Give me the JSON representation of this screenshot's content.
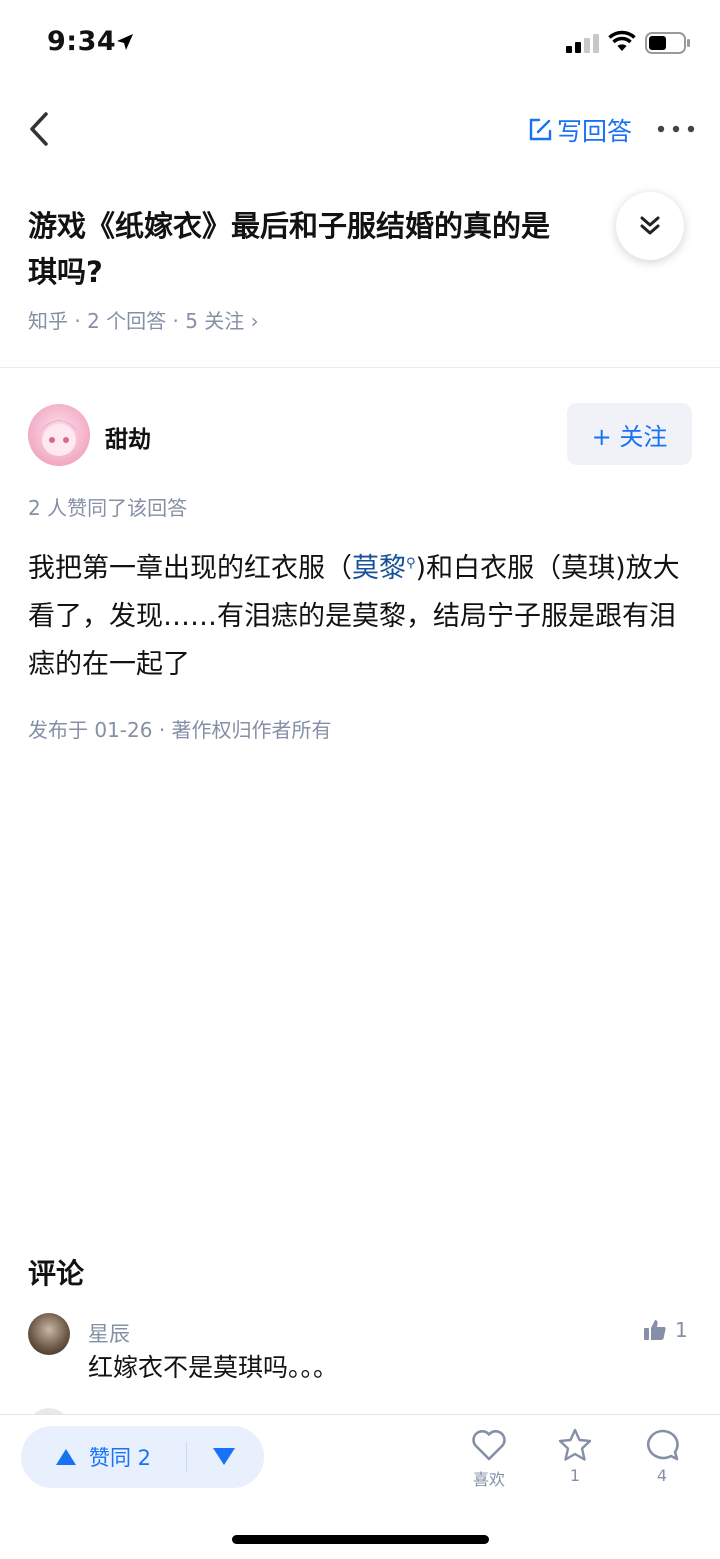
{
  "status_bar": {
    "time": "9:34"
  },
  "nav": {
    "write_answer": "写回答"
  },
  "question": {
    "title": "游戏《纸嫁衣》最后和子服结婚的真的是莫琪吗?",
    "title_line1": "游戏《纸嫁衣》最后和子服结婚的真的是",
    "title_line2": "琪吗?",
    "meta": "知乎 · 2 个回答 · 5 关注 ›"
  },
  "answer": {
    "author": "甜劫",
    "follow_label": "+ 关注",
    "voters": "2 人赞同了该回答",
    "body_part1": "我把第一章出现的红衣服（",
    "body_link": "莫黎",
    "body_part2": ")和白衣服（莫琪)放大看了，发现……有泪痣的是莫黎，结局宁子服是跟有泪痣的在一起了",
    "publish_info": "发布于 01-26 · 著作权归作者所有"
  },
  "comments": {
    "heading": "评论",
    "items": [
      {
        "user": "星辰",
        "text": "红嫁衣不是莫琪吗。。。",
        "likes": "1"
      }
    ]
  },
  "bottom_bar": {
    "vote_up_label": "赞同 2",
    "like_label": "喜欢",
    "favorite_count": "1",
    "comment_count": "4"
  },
  "colors": {
    "accent": "#1772f6",
    "link": "#175199",
    "meta": "#8590a6"
  }
}
